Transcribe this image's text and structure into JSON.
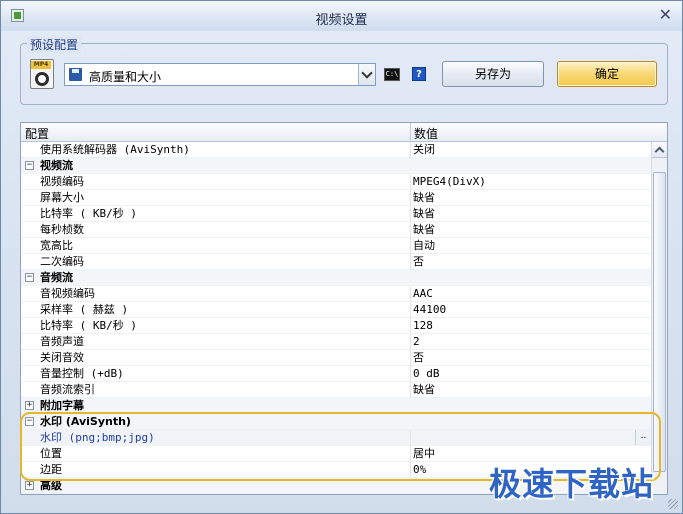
{
  "window": {
    "title": "视频设置"
  },
  "preset": {
    "legend": "预设配置",
    "selected": "高质量和大小",
    "saveas_label": "另存为",
    "ok_label": "确定",
    "media_tag": "MP4",
    "cmd_label": "C:\\",
    "help_label": "?"
  },
  "grid": {
    "col_name": "配置",
    "col_value": "数值",
    "rows": [
      {
        "name": "使用系统解码器 (AviSynth)",
        "value": "关闭"
      },
      {
        "name": "视频流",
        "category": true,
        "expand": "−"
      },
      {
        "name": "视频编码",
        "value": "MPEG4(DivX)"
      },
      {
        "name": "屏幕大小",
        "value": "缺省"
      },
      {
        "name": "比特率 ( KB/秒 )",
        "value": "缺省"
      },
      {
        "name": "每秒桢数",
        "value": "缺省"
      },
      {
        "name": "宽高比",
        "value": "自动"
      },
      {
        "name": "二次编码",
        "value": "否"
      },
      {
        "name": "音频流",
        "category": true,
        "expand": "−"
      },
      {
        "name": "音视频编码",
        "value": "AAC"
      },
      {
        "name": "采样率 ( 赫兹 )",
        "value": "44100"
      },
      {
        "name": "比特率 ( KB/秒 )",
        "value": "128"
      },
      {
        "name": "音频声道",
        "value": "2"
      },
      {
        "name": "关闭音效",
        "value": "否"
      },
      {
        "name": "音量控制 (+dB)",
        "value": "0 dB"
      },
      {
        "name": "音频流索引",
        "value": "缺省"
      },
      {
        "name": "附加字幕",
        "category": true,
        "expand": "+"
      },
      {
        "name": "水印 (AviSynth)",
        "category": true,
        "expand": "−"
      },
      {
        "name": "水印 (png;bmp;jpg)",
        "value": "",
        "selected": true,
        "ellipsis": ".."
      },
      {
        "name": "位置",
        "value": "居中"
      },
      {
        "name": "边距",
        "value": "0%"
      },
      {
        "name": "高级",
        "category": true,
        "expand": "+"
      }
    ]
  },
  "brand": "极速下载站",
  "colors": {
    "accent_highlight": "#e4b82a",
    "brand": "#2e64c4",
    "ok_button": "#f4c849"
  }
}
